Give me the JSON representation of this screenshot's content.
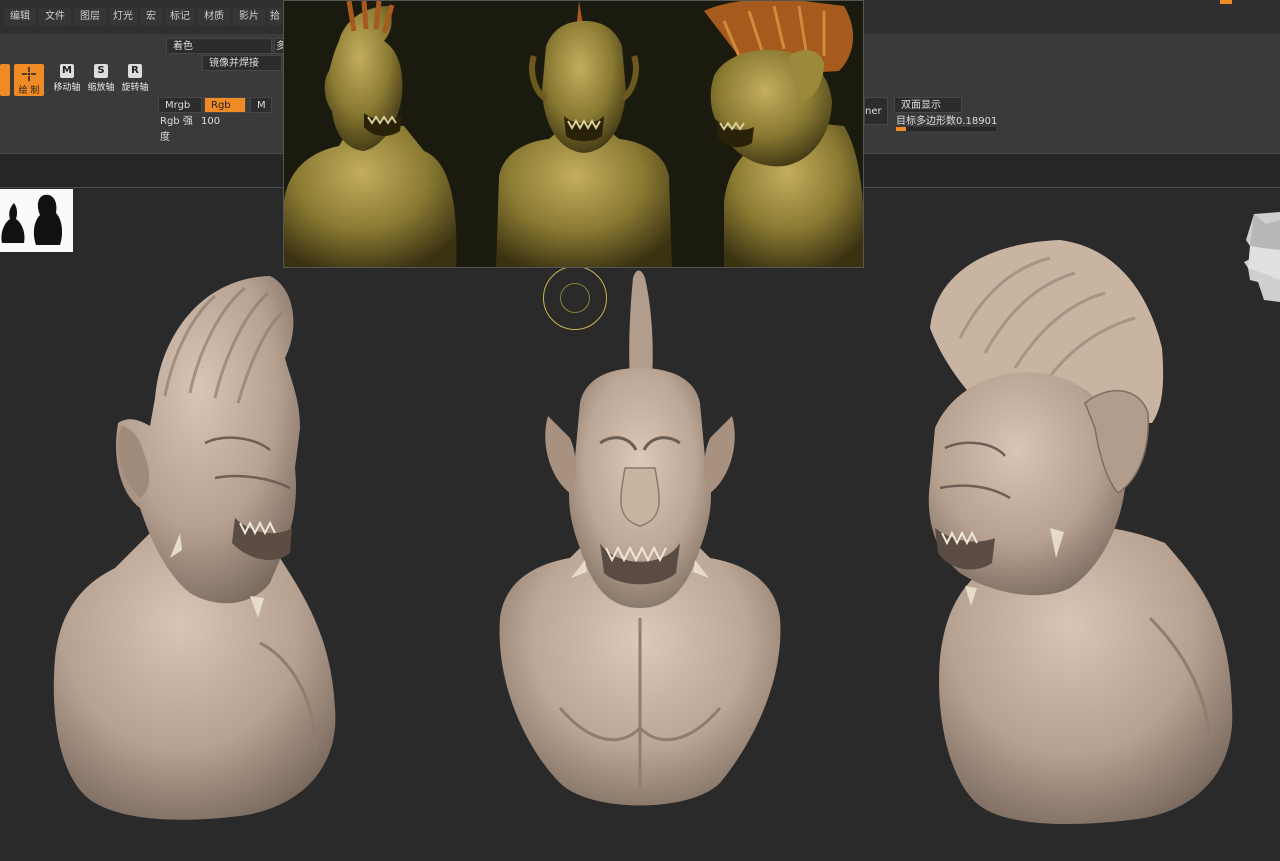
{
  "menu": {
    "items": [
      "编辑",
      "文件",
      "图层",
      "灯光",
      "宏",
      "标记",
      "材质",
      "影片",
      "拾"
    ]
  },
  "toolbar": {
    "color_mode": "着色",
    "color_mode_extra": "多",
    "mirror_weld": "镜像并焊接",
    "tools": [
      {
        "key": "draw",
        "glyph": "",
        "label": "绘 制",
        "active": true
      },
      {
        "key": "move",
        "glyph": "M",
        "label": "移动轴",
        "active": false
      },
      {
        "key": "scale",
        "glyph": "S",
        "label": "缩放轴",
        "active": false
      },
      {
        "key": "rotate",
        "glyph": "R",
        "label": "旋转轴",
        "active": false
      }
    ],
    "mrgb": "Mrgb",
    "rgb": "Rgb",
    "m": "M",
    "rgb_intensity_label": "Rgb 强度",
    "rgb_intensity_value": "100",
    "right_fragment": "ner",
    "double_sided": "双面显示",
    "target_polycount_label": "目标多边形数",
    "target_polycount_value": "0.18901",
    "target_polycount_fraction": 0.1
  },
  "colors": {
    "accent": "#f08a24",
    "clay": "#c2ad9c",
    "clay_shadow": "#7a6a5e",
    "bronze": "#8a7a32",
    "background": "#2a2a2a"
  },
  "icons": {
    "draw": "draw-crosshair-icon",
    "move": "move-axis-icon",
    "scale": "scale-axis-icon",
    "rotate": "rotate-axis-icon",
    "navcube": "navigation-head-icon",
    "brush": "brush-cursor-icon"
  }
}
